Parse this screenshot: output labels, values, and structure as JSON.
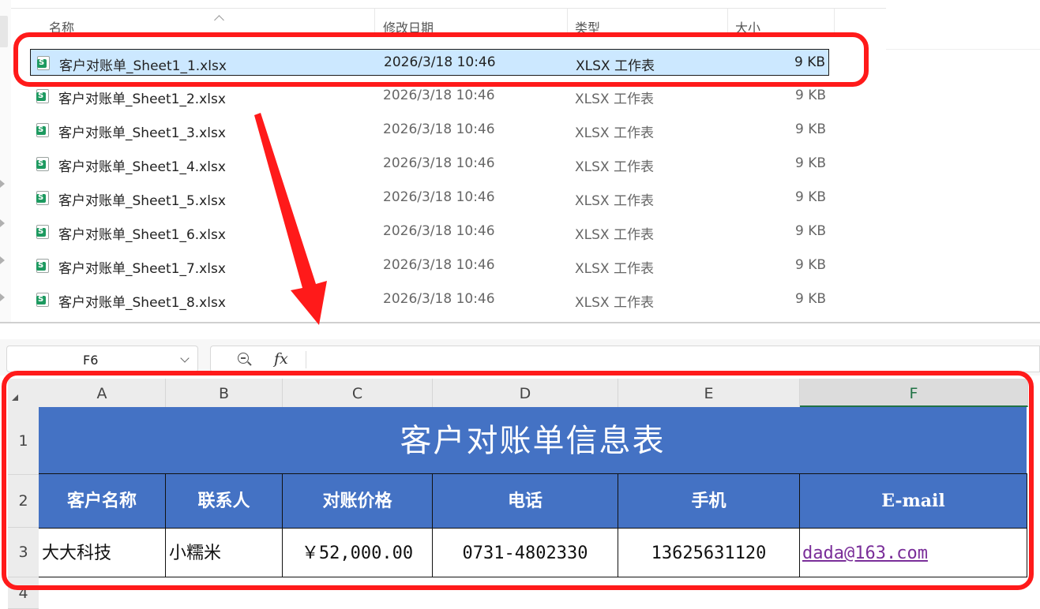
{
  "explorer": {
    "columns": {
      "name": "名称",
      "modified": "修改日期",
      "type": "类型",
      "size": "大小"
    },
    "files": [
      {
        "name": "客户对账单_Sheet1_1.xlsx",
        "modified": "2026/3/18 10:46",
        "type": "XLSX 工作表",
        "size": "9 KB",
        "selected": true
      },
      {
        "name": "客户对账单_Sheet1_2.xlsx",
        "modified": "2026/3/18 10:46",
        "type": "XLSX 工作表",
        "size": "9 KB"
      },
      {
        "name": "客户对账单_Sheet1_3.xlsx",
        "modified": "2026/3/18 10:46",
        "type": "XLSX 工作表",
        "size": "9 KB"
      },
      {
        "name": "客户对账单_Sheet1_4.xlsx",
        "modified": "2026/3/18 10:46",
        "type": "XLSX 工作表",
        "size": "9 KB"
      },
      {
        "name": "客户对账单_Sheet1_5.xlsx",
        "modified": "2026/3/18 10:46",
        "type": "XLSX 工作表",
        "size": "9 KB"
      },
      {
        "name": "客户对账单_Sheet1_6.xlsx",
        "modified": "2026/3/18 10:46",
        "type": "XLSX 工作表",
        "size": "9 KB"
      },
      {
        "name": "客户对账单_Sheet1_7.xlsx",
        "modified": "2026/3/18 10:46",
        "type": "XLSX 工作表",
        "size": "9 KB"
      },
      {
        "name": "客户对账单_Sheet1_8.xlsx",
        "modified": "2026/3/18 10:46",
        "type": "XLSX 工作表",
        "size": "9 KB"
      }
    ],
    "file_icon_letter": "S"
  },
  "excel": {
    "name_box": "F6",
    "fx_label": "fx",
    "columns": [
      "A",
      "B",
      "C",
      "D",
      "E",
      "F"
    ],
    "active_column": "F",
    "rows": [
      "1",
      "2",
      "3",
      "4"
    ],
    "title": "客户对账单信息表",
    "headers": [
      "客户名称",
      "联系人",
      "对账价格",
      "电话",
      "手机",
      "E-mail"
    ],
    "data_row": [
      "大大科技",
      "小糯米",
      "￥52,000.00",
      "0731-4802330",
      "13625631120",
      "dada@163.com"
    ],
    "header_color": "#4472c4",
    "link_color": "#7a2e99"
  },
  "annotation_color": "#ff1a1a",
  "icons": [
    "xlsx-file-icon",
    "zoom-out-icon",
    "chevron-down-icon",
    "sort-caret-icon",
    "select-all-icon",
    "red-arrow-icon"
  ]
}
